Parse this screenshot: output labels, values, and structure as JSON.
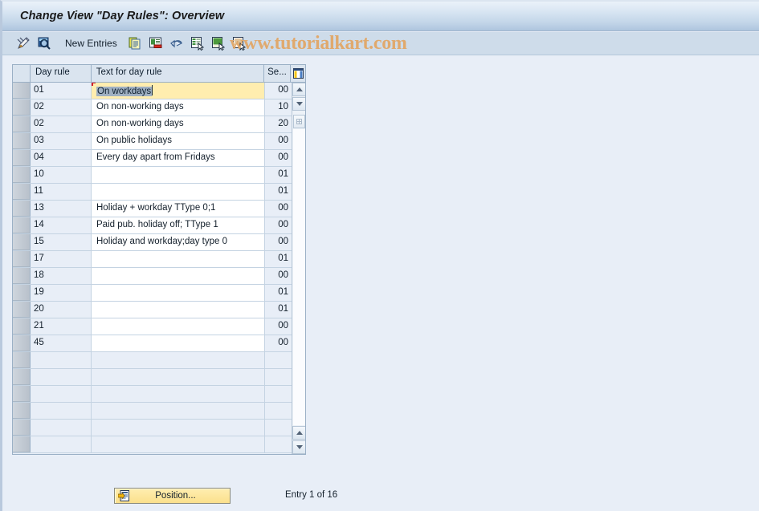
{
  "window": {
    "title": "Change View \"Day Rules\": Overview"
  },
  "toolbar": {
    "icons_left": [
      {
        "name": "display-change-icon",
        "title": "Display <-> Change"
      },
      {
        "name": "check-entries-icon",
        "title": "Check Entries"
      }
    ],
    "new_entries_label": "New Entries",
    "icons_right": [
      {
        "name": "copy-as-icon",
        "title": "Copy As..."
      },
      {
        "name": "delete-icon",
        "title": "Delete"
      },
      {
        "name": "undo-icon",
        "title": "Undo Change"
      },
      {
        "name": "select-all-icon",
        "title": "Select All"
      },
      {
        "name": "deselect-all-icon",
        "title": "Deselect All"
      },
      {
        "name": "select-block-icon",
        "title": "Select Block"
      }
    ],
    "watermark": "www.tutorialkart.com",
    "watermark_color": "#e0a96d"
  },
  "table": {
    "config_icon": "table-settings-icon",
    "columns": [
      "Day rule",
      "Text for day rule",
      "Se..."
    ],
    "rows": [
      {
        "key": "01",
        "text": "On workdays",
        "seq": "00",
        "selected": true
      },
      {
        "key": "02",
        "text": "On non-working days",
        "seq": "10",
        "selected": false
      },
      {
        "key": "02",
        "text": "On non-working days",
        "seq": "20",
        "selected": false
      },
      {
        "key": "03",
        "text": "On public holidays",
        "seq": "00",
        "selected": false
      },
      {
        "key": "04",
        "text": "Every day apart from Fridays",
        "seq": "00",
        "selected": false
      },
      {
        "key": "10",
        "text": "",
        "seq": "01",
        "selected": false
      },
      {
        "key": "11",
        "text": "",
        "seq": "01",
        "selected": false
      },
      {
        "key": "13",
        "text": "Holiday + workday TType 0;1",
        "seq": "00",
        "selected": false
      },
      {
        "key": "14",
        "text": "Paid pub. holiday off; TType 1",
        "seq": "00",
        "selected": false
      },
      {
        "key": "15",
        "text": "Holiday and workday;day type 0",
        "seq": "00",
        "selected": false
      },
      {
        "key": "17",
        "text": "",
        "seq": "01",
        "selected": false
      },
      {
        "key": "18",
        "text": "",
        "seq": "00",
        "selected": false
      },
      {
        "key": "19",
        "text": "",
        "seq": "01",
        "selected": false
      },
      {
        "key": "20",
        "text": "",
        "seq": "01",
        "selected": false
      },
      {
        "key": "21",
        "text": "",
        "seq": "00",
        "selected": false
      },
      {
        "key": "45",
        "text": "",
        "seq": "00",
        "selected": false
      },
      {
        "key": "",
        "text": "",
        "seq": "",
        "selected": false
      },
      {
        "key": "",
        "text": "",
        "seq": "",
        "selected": false
      },
      {
        "key": "",
        "text": "",
        "seq": "",
        "selected": false
      },
      {
        "key": "",
        "text": "",
        "seq": "",
        "selected": false
      },
      {
        "key": "",
        "text": "",
        "seq": "",
        "selected": false
      },
      {
        "key": "",
        "text": "",
        "seq": "",
        "selected": false
      }
    ]
  },
  "footer": {
    "position_button_label": "Position...",
    "position_button_icon": "position-icon",
    "entry_status": "Entry 1 of 16"
  },
  "colors": {
    "title_bar_top": "#eaf1f9",
    "title_bar_bottom": "#aec5de",
    "toolbar_bg": "#cedcea",
    "page_bg": "#e8eef7",
    "selected_row_bg": "#ffedaf",
    "grid_border": "#9bb0c6",
    "button_yellow": "#fbe08c"
  }
}
